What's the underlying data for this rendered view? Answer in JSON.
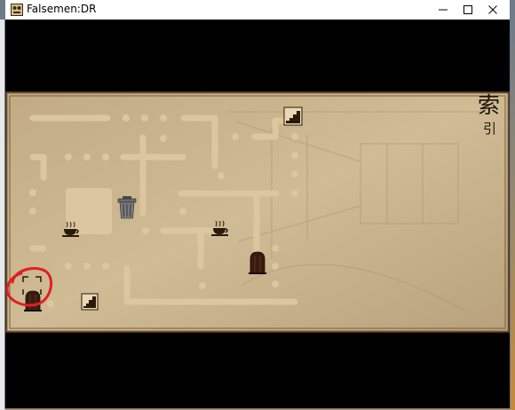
{
  "window": {
    "title": "Falsemen:DR"
  },
  "index_glyphs": {
    "large": "索",
    "small": "引"
  },
  "icons": {
    "app": "game-app-icon",
    "minimize": "minimize-icon",
    "maximize": "maximize-icon",
    "close": "close-icon",
    "stairs": "stairs-icon",
    "teacup": "teacup-icon",
    "trash_can": "trash-can-icon",
    "door": "wooden-door-icon",
    "player": "player-marker-icon"
  },
  "colors": {
    "parchment": "#c9b48e",
    "path": "#dcc6a0",
    "frame": "#6e5536",
    "annotation": "#e02020"
  }
}
